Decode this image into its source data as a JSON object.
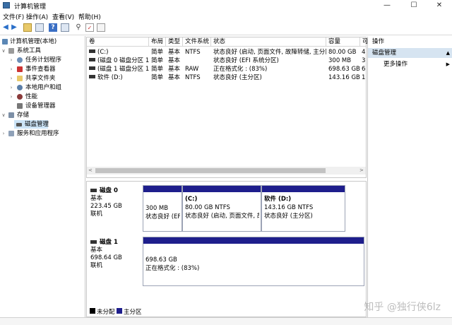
{
  "window": {
    "title": "计算机管理",
    "min": "—",
    "max": "☐",
    "close": "✕"
  },
  "menu": [
    "文件(F)",
    "操作(A)",
    "查看(V)",
    "帮助(H)"
  ],
  "tree": {
    "root": "计算机管理(本地)",
    "system_tools": "系统工具",
    "items": [
      "任务计划程序",
      "事件查看器",
      "共享文件夹",
      "本地用户和组",
      "性能",
      "设备管理器"
    ],
    "storage": "存储",
    "disk_mgmt": "磁盘管理",
    "services": "服务和应用程序"
  },
  "volumes": {
    "headers": [
      "卷",
      "布局",
      "类型",
      "文件系统",
      "状态",
      "容量",
      "可"
    ],
    "rows": [
      [
        "(C:)",
        "简单",
        "基本",
        "NTFS",
        "状态良好 (启动, 页面文件, 故障转储, 主分区)",
        "80.00 GB",
        "4"
      ],
      [
        "(磁盘 0 磁盘分区 1)",
        "简单",
        "基本",
        "",
        "状态良好 (EFI 系统分区)",
        "300 MB",
        "3"
      ],
      [
        "(磁盘 1 磁盘分区 1)",
        "简单",
        "基本",
        "RAW",
        "正在格式化 : (83%)",
        "698.63 GB",
        "6"
      ],
      [
        "软件 (D:)",
        "简单",
        "基本",
        "NTFS",
        "状态良好 (主分区)",
        "143.16 GB",
        "1"
      ]
    ]
  },
  "disks": [
    {
      "name": "磁盘 0",
      "type": "基本",
      "size": "223.45 GB",
      "status": "联机",
      "partitions": [
        {
          "name": "",
          "size": "300 MB",
          "status": "状态良好 (EF"
        },
        {
          "name": "(C:)",
          "size": "80.00 GB NTFS",
          "status": "状态良好 (启动, 页面文件, 故"
        },
        {
          "name": "软件  (D:)",
          "size": "143.16 GB NTFS",
          "status": "状态良好 (主分区)"
        }
      ]
    },
    {
      "name": "磁盘 1",
      "type": "基本",
      "size": "698.64 GB",
      "status": "联机",
      "partitions": [
        {
          "name": "",
          "size": "698.63 GB",
          "status": "正在格式化 : (83%)"
        }
      ]
    }
  ],
  "legend": {
    "unallocated": "未分配",
    "primary": "主分区"
  },
  "actions": {
    "header": "操作",
    "section": "磁盘管理",
    "more": "更多操作"
  },
  "watermark": "知乎 @独行侠6lz",
  "colors": {
    "primary_partition": "#1e1e8c",
    "unallocated": "#000000",
    "selection": "#cce4f7"
  }
}
